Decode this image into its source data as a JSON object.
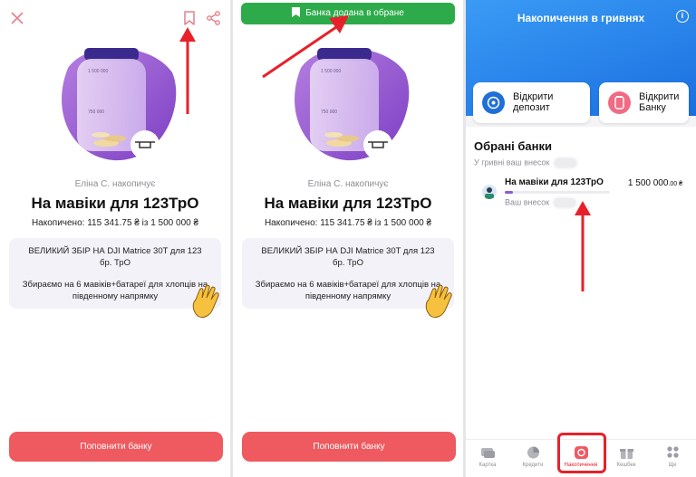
{
  "panel1": {
    "saver_text": "Еліна С. накопичує",
    "title": "На мавіки для 123ТрО",
    "progress_text": "Накопичено: 115 341.75 ₴ із 1 500 000 ₴",
    "description_line1": "ВЕЛИКИЙ ЗБІР НА DJI Matrice 30T для 123 бр. ТрО",
    "description_line2": "Збираємо на 6 мавіків+батареї для хлопців на південному напрямку",
    "button_label": "Поповнити банку",
    "jar_label_top": "1 500 000",
    "jar_label_mid": "750 000"
  },
  "panel2": {
    "toast_text": "Банка додана в обране",
    "saver_text": "Еліна С. накопичує",
    "title": "На мавіки для 123ТрО",
    "progress_text": "Накопичено: 115 341.75 ₴ із 1 500 000 ₴",
    "description_line1": "ВЕЛИКИЙ ЗБІР НА DJI Matrice 30T для 123 бр. ТрО",
    "description_line2": "Збираємо на 6 мавіків+батареї для хлопців на південному напрямку",
    "button_label": "Поповнити банку",
    "jar_label_top": "1 500 000",
    "jar_label_mid": "750 000"
  },
  "panel3": {
    "header_title": "Накопичення в гривнях",
    "info_icon": "i",
    "action_deposit": "Відкрити депозит",
    "action_jar": "Відкрити Банку",
    "section_title": "Обрані банки",
    "section_sub": "У гривні ваш внесок",
    "bank": {
      "name": "На мавіки для 123ТрО",
      "amount": "1 500 000",
      "amount_decimals": ".00 ₴",
      "contribution_label": "Ваш внесок",
      "progress": 0.077
    },
    "nav": [
      {
        "label": "Картка",
        "icon": "cards-icon"
      },
      {
        "label": "Кредити",
        "icon": "pie-chart-icon"
      },
      {
        "label": "Накопичення",
        "icon": "savings-icon"
      },
      {
        "label": "Кешбек",
        "icon": "gift-icon"
      },
      {
        "label": "Ще",
        "icon": "more-grid-icon"
      }
    ]
  },
  "colors": {
    "accent_red": "#ee5a5f",
    "toast_green": "#2dab4a",
    "header_blue": "#1a6fe0",
    "progress_purple": "#8b5cd6",
    "annotation_red": "#e8202a"
  }
}
